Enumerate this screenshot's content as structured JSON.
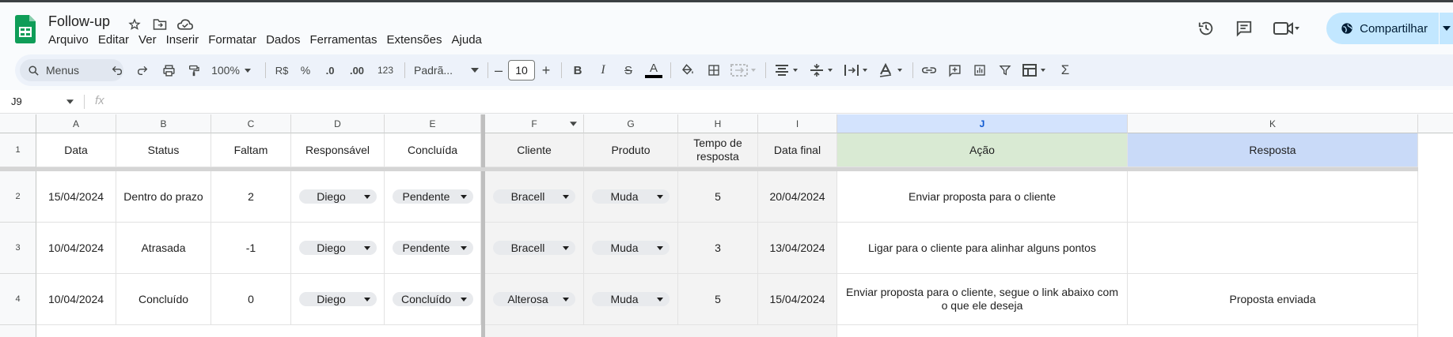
{
  "title": "Follow-up",
  "menu": [
    "Arquivo",
    "Editar",
    "Ver",
    "Inserir",
    "Formatar",
    "Dados",
    "Ferramentas",
    "Extensões",
    "Ajuda"
  ],
  "share_label": "Compartilhar",
  "toolbar": {
    "menus_label": "Menus",
    "zoom": "100%",
    "currency": "R$",
    "percent": "%",
    "dec_decrease": ".0",
    "dec_increase": ".00",
    "number_format": "123",
    "font": "Padrã...",
    "font_size": "10",
    "bold": "B",
    "italic": "I",
    "strike": "S",
    "text_color": "A",
    "functions": "Σ"
  },
  "formula_bar": {
    "name_box": "J9",
    "fx": "fx"
  },
  "columns": [
    "A",
    "B",
    "C",
    "D",
    "E",
    "F",
    "G",
    "H",
    "I",
    "J",
    "K"
  ],
  "rows": [
    "1",
    "2",
    "3",
    "4"
  ],
  "headers": {
    "a": "Data",
    "b": "Status",
    "c": "Faltam",
    "d": "Responsável",
    "e": "Concluída",
    "f": "Cliente",
    "g": "Produto",
    "h": "Tempo de resposta",
    "i": "Data final",
    "j": "Ação",
    "k": "Resposta"
  },
  "data_rows": [
    {
      "a": "15/04/2024",
      "b": "Dentro do prazo",
      "c": "2",
      "d": "Diego",
      "e": "Pendente",
      "f": "Bracell",
      "g": "Muda",
      "h": "5",
      "i": "20/04/2024",
      "j": "Enviar proposta para o cliente",
      "k": ""
    },
    {
      "a": "10/04/2024",
      "b": "Atrasada",
      "c": "-1",
      "d": "Diego",
      "e": "Pendente",
      "f": "Bracell",
      "g": "Muda",
      "h": "3",
      "i": "13/04/2024",
      "j": "Ligar para o cliente para alinhar alguns pontos",
      "k": ""
    },
    {
      "a": "10/04/2024",
      "b": "Concluído",
      "c": "0",
      "d": "Diego",
      "e": "Concluído",
      "f": "Alterosa",
      "g": "Muda",
      "h": "5",
      "i": "15/04/2024",
      "j": "Enviar proposta para o cliente, segue o link abaixo com o que ele deseja",
      "k": "Proposta enviada"
    }
  ],
  "colors": {
    "share_bg": "#c2e7ff",
    "toolbar_bg": "#edf2fa",
    "acao_header": "#d9ead3",
    "resposta_header": "#c9daf8",
    "frozen_bg": "#f3f3f3",
    "selected_col": "#d3e3fd"
  }
}
